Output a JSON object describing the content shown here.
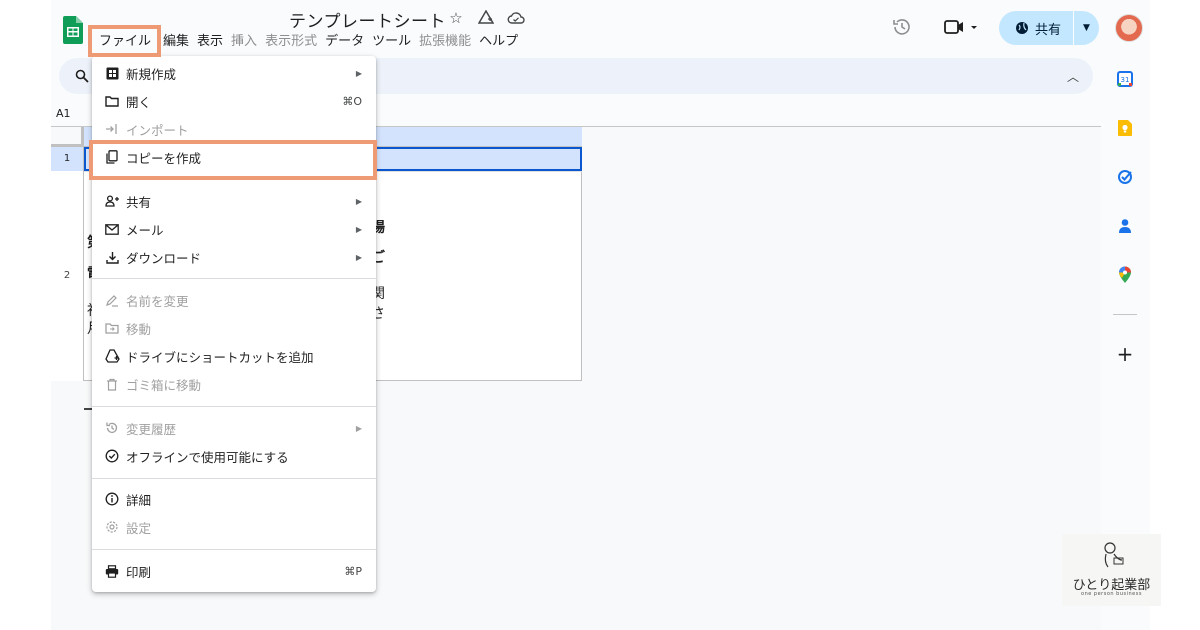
{
  "doc": {
    "title": "テンプレートシート"
  },
  "menubar": {
    "items": [
      "ファイル",
      "編集",
      "表示",
      "挿入",
      "表示形式",
      "データ",
      "ツール",
      "拡張機能",
      "ヘルプ"
    ]
  },
  "share": {
    "label": "共有"
  },
  "namebox": {
    "value": "A1"
  },
  "rows": [
    "1",
    "2"
  ],
  "cell_fragments": [
    "第",
    "電",
    "社",
    "月",
    "場",
    "ご",
    "関",
    "さ"
  ],
  "file_menu": {
    "items": [
      {
        "label": "新規作成",
        "icon": "new-spreadsheet-icon",
        "submenu": true,
        "disabled": false
      },
      {
        "label": "開く",
        "icon": "folder-icon",
        "shortcut": "⌘O",
        "disabled": false
      },
      {
        "label": "インポート",
        "icon": "import-icon",
        "disabled": true
      },
      {
        "label": "コピーを作成",
        "icon": "copy-icon",
        "disabled": false
      },
      {
        "label": "共有",
        "icon": "person-add-icon",
        "submenu": true,
        "disabled": false
      },
      {
        "label": "メール",
        "icon": "mail-icon",
        "submenu": true,
        "disabled": false
      },
      {
        "label": "ダウンロード",
        "icon": "download-icon",
        "submenu": true,
        "disabled": false
      },
      {
        "label": "名前を変更",
        "icon": "rename-icon",
        "disabled": true
      },
      {
        "label": "移動",
        "icon": "move-folder-icon",
        "disabled": true
      },
      {
        "label": "ドライブにショートカットを追加",
        "icon": "drive-add-icon",
        "disabled": false
      },
      {
        "label": "ゴミ箱に移動",
        "icon": "trash-icon",
        "disabled": true
      },
      {
        "label": "変更履歴",
        "icon": "history-icon",
        "submenu": true,
        "disabled": true
      },
      {
        "label": "オフラインで使用可能にする",
        "icon": "offline-check-icon",
        "disabled": false
      },
      {
        "label": "詳細",
        "icon": "info-icon",
        "disabled": false
      },
      {
        "label": "設定",
        "icon": "settings-icon",
        "disabled": true
      },
      {
        "label": "印刷",
        "icon": "print-icon",
        "shortcut": "⌘P",
        "disabled": false
      }
    ]
  },
  "side_panel": [
    "calendar-icon",
    "keep-icon",
    "tasks-icon",
    "contacts-icon",
    "maps-icon",
    "add-icon"
  ],
  "calendar_day": "31",
  "watermark": {
    "main": "ひとり起業部",
    "sub": "one person business"
  },
  "colors": {
    "highlight": "#ee9a74",
    "share_bg": "#c2e7ff",
    "selection": "#0b57d0",
    "sheets_green": "#0f9d58"
  }
}
